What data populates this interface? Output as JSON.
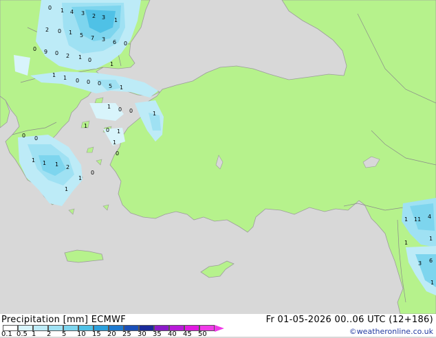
{
  "footer": {
    "title": "Precipitation [mm] ECMWF",
    "datetime": "Fr 01-05-2026 00..06 UTC (12+186)",
    "credit": "©weatheronline.co.uk"
  },
  "legend": {
    "ticks": [
      "0.1",
      "0.5",
      "1",
      "2",
      "5",
      "10",
      "15",
      "20",
      "25",
      "30",
      "35",
      "40",
      "45",
      "50"
    ],
    "colors": [
      "#ffffff",
      "#d8f4fb",
      "#bdebf7",
      "#9fe1f3",
      "#7dd5ee",
      "#4fc1e6",
      "#2ca0dc",
      "#1e7ad0",
      "#1a4fb8",
      "#1a2a9a",
      "#8a1ac8",
      "#b81ad8",
      "#e01ae0",
      "#f03ae8"
    ]
  },
  "map": {
    "colors": {
      "sea": "#d8d8d8",
      "land": "#b6f28c",
      "coast": "#9c9c9c",
      "border": "#8a8a8a"
    },
    "precip_values": [
      {
        "v": "0"
      },
      {
        "v": "1"
      },
      {
        "v": "4"
      },
      {
        "v": "3"
      },
      {
        "v": "2"
      },
      {
        "v": "3"
      },
      {
        "v": "1"
      },
      {
        "v": "2"
      },
      {
        "v": "0"
      },
      {
        "v": "1"
      },
      {
        "v": "5"
      },
      {
        "v": "7"
      },
      {
        "v": "3"
      },
      {
        "v": "6"
      },
      {
        "v": "0"
      },
      {
        "v": "0"
      },
      {
        "v": "9"
      },
      {
        "v": "0"
      },
      {
        "v": "2"
      },
      {
        "v": "1"
      },
      {
        "v": "0"
      },
      {
        "v": "1"
      },
      {
        "v": "1"
      },
      {
        "v": "1"
      },
      {
        "v": "0"
      },
      {
        "v": "0"
      },
      {
        "v": "0"
      },
      {
        "v": "5"
      },
      {
        "v": "1"
      },
      {
        "v": "1"
      },
      {
        "v": "0"
      },
      {
        "v": "0"
      },
      {
        "v": "1"
      },
      {
        "v": "1"
      },
      {
        "v": "1"
      },
      {
        "v": "0"
      },
      {
        "v": "1"
      },
      {
        "v": "0"
      },
      {
        "v": "0"
      },
      {
        "v": "0"
      },
      {
        "v": "1"
      },
      {
        "v": "1"
      },
      {
        "v": "1"
      },
      {
        "v": "2"
      },
      {
        "v": "1"
      },
      {
        "v": "0"
      },
      {
        "v": "1"
      },
      {
        "v": "1"
      },
      {
        "v": "11"
      },
      {
        "v": "4"
      },
      {
        "v": "1"
      },
      {
        "v": "1"
      },
      {
        "v": "3"
      },
      {
        "v": "6"
      },
      {
        "v": "1"
      }
    ]
  }
}
